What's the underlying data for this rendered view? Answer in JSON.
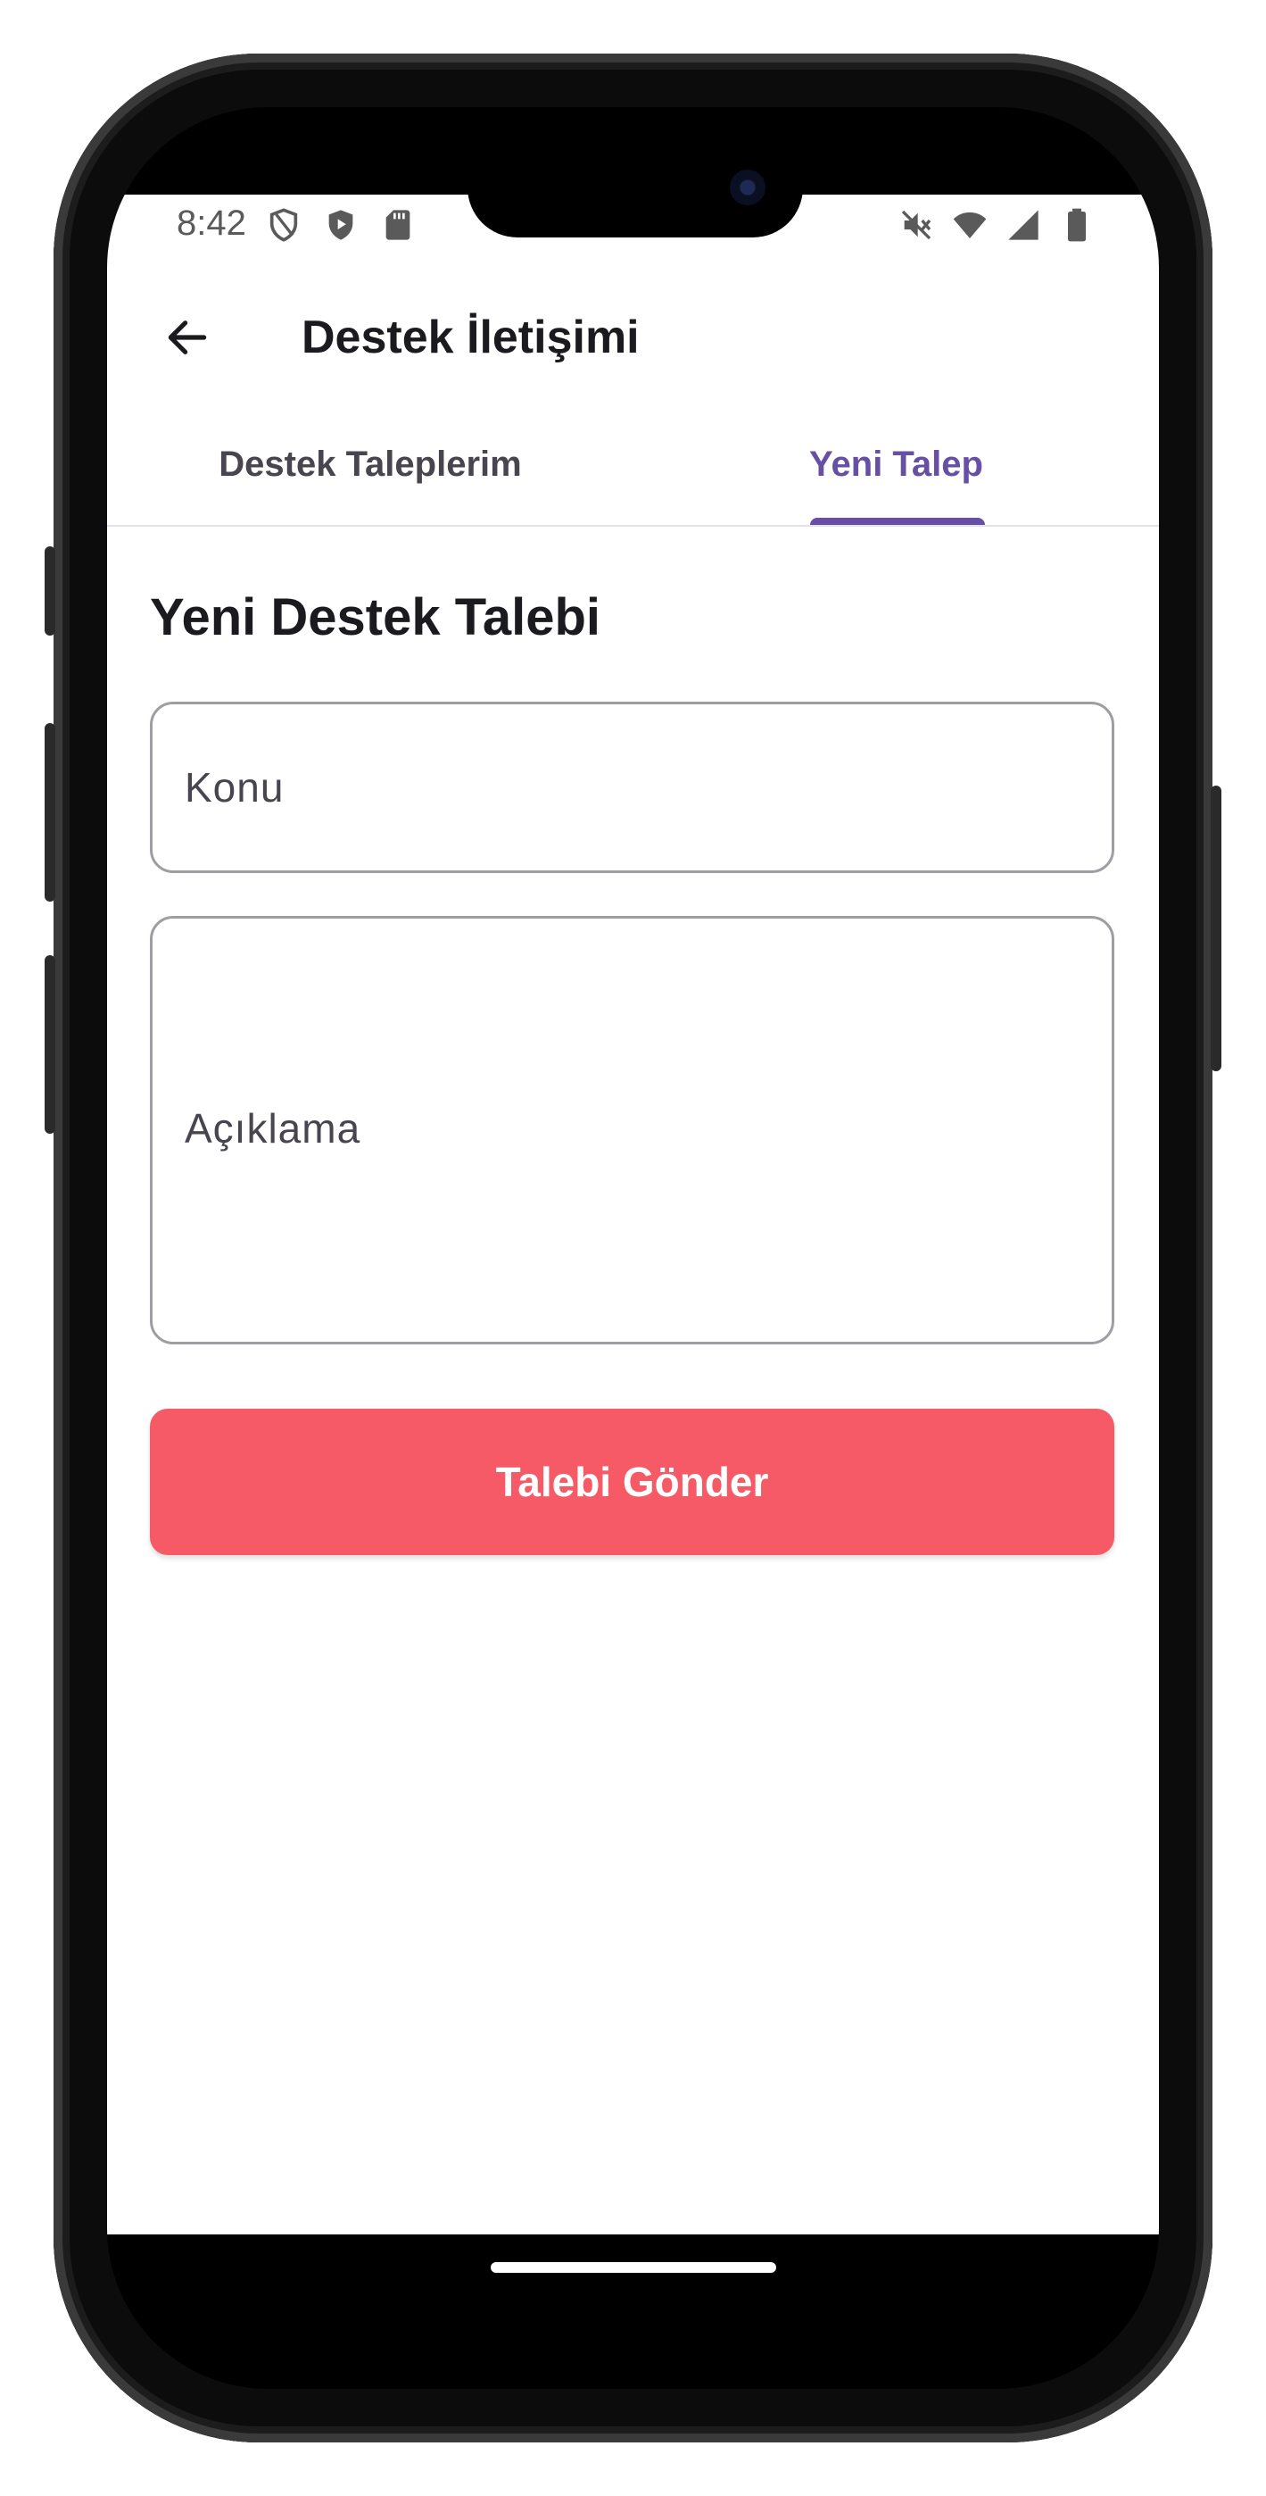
{
  "status_bar": {
    "time": "8:42",
    "left_icons": [
      "shield-outline-icon",
      "shield-play-icon",
      "sd-card-icon"
    ],
    "right_icons": [
      "mute-icon",
      "wifi-icon",
      "signal-icon",
      "battery-icon"
    ]
  },
  "app_bar": {
    "title": "Destek İletişimi",
    "back_icon": "arrow-left-icon"
  },
  "tabs": [
    {
      "label": "Destek Taleplerim",
      "selected": false
    },
    {
      "label": "Yeni Talep",
      "selected": true
    }
  ],
  "form": {
    "title": "Yeni Destek Talebi",
    "subject": {
      "value": "",
      "placeholder": "Konu"
    },
    "description": {
      "value": "",
      "placeholder": "Açıklama"
    },
    "submit_label": "Talebi Gönder"
  },
  "colors": {
    "accent": "#6750a4",
    "submit": "#f65a66",
    "text": "#1b1b1f"
  }
}
